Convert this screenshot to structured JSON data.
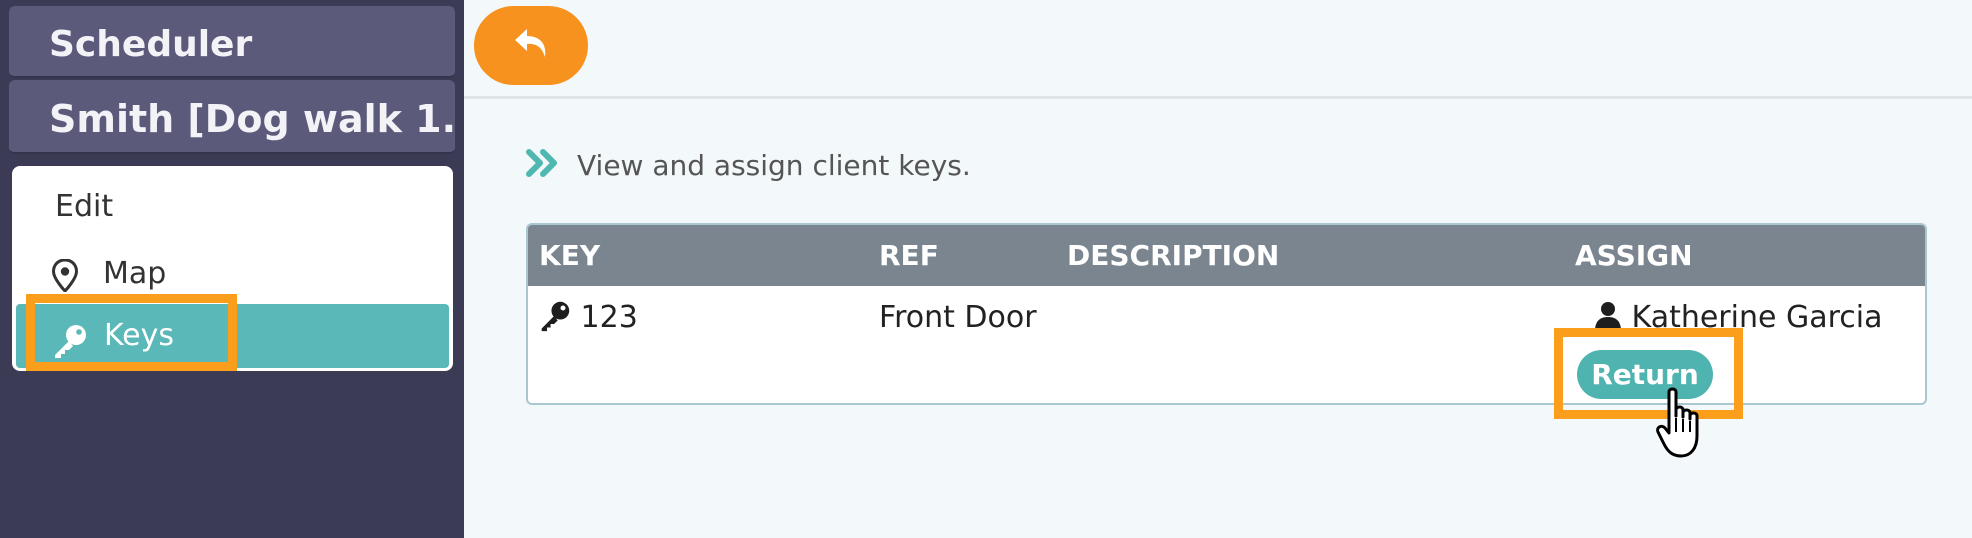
{
  "sidebar": {
    "title": "Scheduler",
    "subtitle": "Smith [Dog walk 1...",
    "items": [
      {
        "label": "Edit",
        "icon": ""
      },
      {
        "label": "Map",
        "icon": "map-pin-icon"
      },
      {
        "label": "Keys",
        "icon": "key-icon",
        "active": true
      }
    ]
  },
  "toolbar": {
    "back_icon": "undo-arrow-icon"
  },
  "main": {
    "intro": "View and assign client keys.",
    "table": {
      "columns": [
        "KEY",
        "REF",
        "DESCRIPTION",
        "ASSIGN"
      ],
      "rows": [
        {
          "key": "123",
          "ref": "Front Door",
          "description": "",
          "assigned_to": "Katherine Garcia",
          "action": "Return"
        }
      ]
    }
  },
  "colors": {
    "sidebar_bg": "#3c3b56",
    "header_bg": "#5b5a7a",
    "accent_orange": "#f8921f",
    "highlight": "#fb9e1b",
    "teal": "#5bb8b8",
    "table_header": "#7a8590"
  }
}
